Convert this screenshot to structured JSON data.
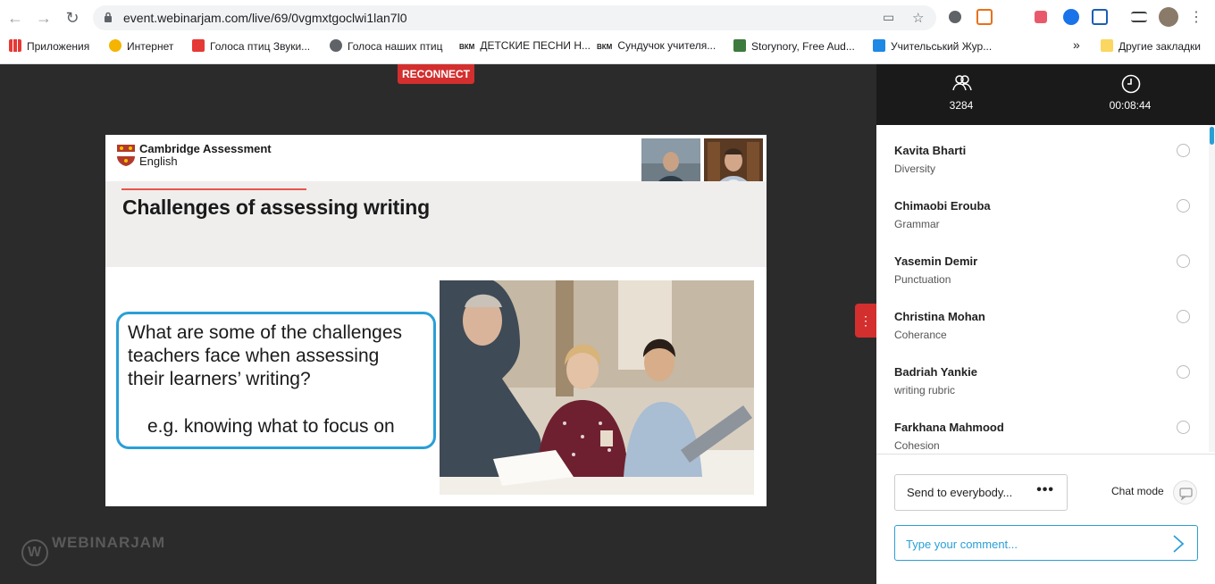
{
  "browser": {
    "url": "event.webinarjam.com/live/69/0vgmxtgoclwi1lan7l0",
    "bookmarks": [
      {
        "label": "Приложения"
      },
      {
        "label": "Интернет"
      },
      {
        "label": "Голоса птиц Звуки..."
      },
      {
        "label": "Голоса наших птиц"
      },
      {
        "label": "ДЕТСКИЕ ПЕСНИ Н..."
      },
      {
        "label": "Сундучок учителя..."
      },
      {
        "label": "Storynory, Free Aud..."
      },
      {
        "label": "Учительський Жур..."
      }
    ],
    "bm_prefix_vkm": "ВКМ",
    "more_bookmarks": "»",
    "other_bookmarks": "Другие закладки"
  },
  "stage": {
    "reconnect_label": "RECONNECT",
    "brand": "WEBINARJAM"
  },
  "slide": {
    "logo_line1": "Cambridge Assessment",
    "logo_line2": "English",
    "title": "Challenges of assessing writing",
    "question_lines": [
      "What are some of the challenges",
      "teachers face when assessing",
      "their learners’ writing?"
    ],
    "example": "e.g. knowing what to focus on"
  },
  "sidebar": {
    "attendees": "3284",
    "timer": "00:08:44",
    "messages": [
      {
        "name": "Kavita Bharti",
        "text": "Diversity"
      },
      {
        "name": "Chimaobi Erouba",
        "text": "Grammar"
      },
      {
        "name": "Yasemin Demir",
        "text": "Punctuation"
      },
      {
        "name": "Christina Mohan",
        "text": "Coherance"
      },
      {
        "name": "Badriah Yankie",
        "text": "writing rubric"
      },
      {
        "name": "Farkhana Mahmood",
        "text": "Cohesion"
      }
    ],
    "send_to": "Send to everybody...",
    "send_dots": "•••",
    "chat_mode": "Chat mode",
    "comment_placeholder": "Type your comment..."
  },
  "colors": {
    "accent": "#2a9fd6",
    "reconnect": "#d32f2f",
    "title_rule": "#e8564a"
  }
}
